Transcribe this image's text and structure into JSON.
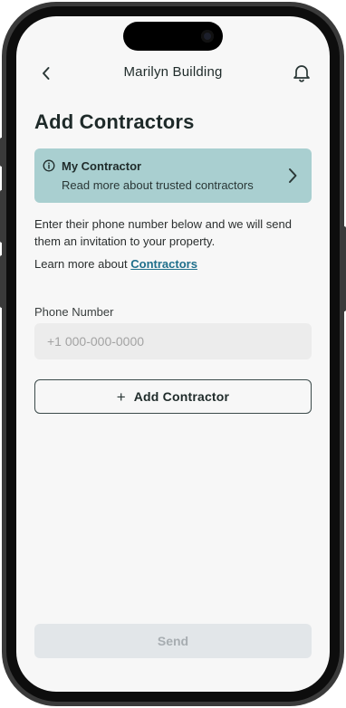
{
  "header": {
    "title": "Marilyn Building",
    "back_icon": "chevron-left-icon",
    "notification_icon": "bell-icon"
  },
  "page": {
    "heading": "Add Contractors"
  },
  "info_card": {
    "title": "My Contractor",
    "subtitle": "Read more about trusted contractors",
    "icon": "info-circle-icon",
    "chevron": "chevron-right-icon",
    "background_color": "#a9cfd0"
  },
  "description": "Enter their phone number below and we will send them an invitation to your property.",
  "learn_more": {
    "prefix": "Learn more about",
    "link_label": "Contractors",
    "link_color": "#1f6f8b"
  },
  "phone_field": {
    "label": "Phone Number",
    "placeholder": "+1 000-000-0000",
    "value": ""
  },
  "add_contractor_button": {
    "icon": "plus-icon",
    "label": "Add Contractor"
  },
  "send_button": {
    "label": "Send",
    "state": "disabled"
  }
}
